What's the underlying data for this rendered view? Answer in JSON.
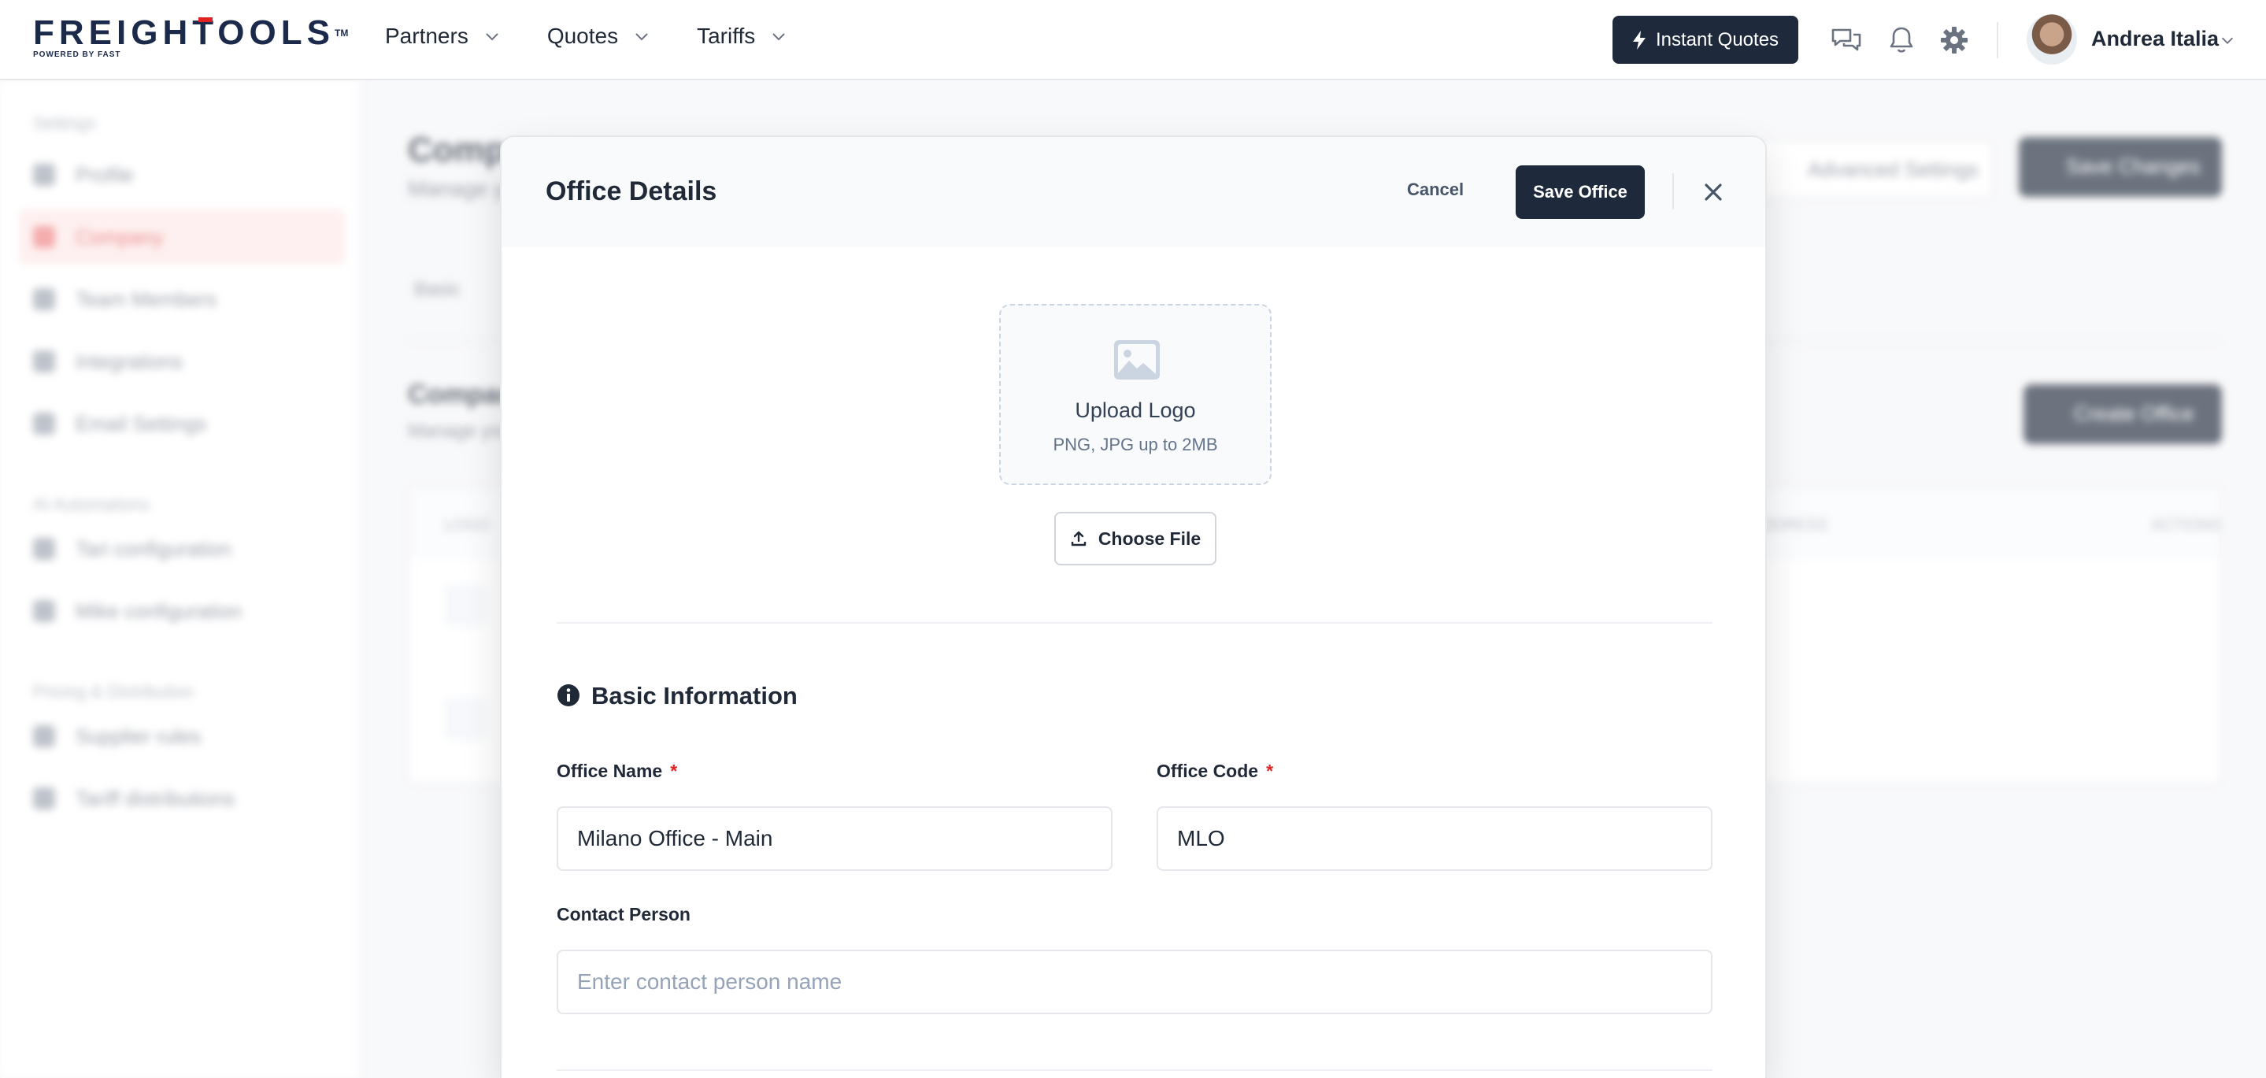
{
  "header": {
    "logo_text": "FREIGHTOOLS",
    "logo_tm": "TM",
    "logo_sub": "POWERED BY FAST",
    "nav": [
      {
        "label": "Partners"
      },
      {
        "label": "Quotes"
      },
      {
        "label": "Tariffs"
      }
    ],
    "instant_quotes_label": "Instant Quotes",
    "user_name": "Andrea Italia"
  },
  "sidebar": {
    "section_settings": "Settings",
    "items_settings": [
      "Profile",
      "Company",
      "Team Members",
      "Integrations",
      "Email Settings"
    ],
    "section_ai": "AI Automations",
    "items_ai": [
      "Tari configuration",
      "Mike configuration"
    ],
    "section_pricing": "Pricing & Distribution",
    "items_pricing": [
      "Supplier rules",
      "Tariff distributions"
    ]
  },
  "background": {
    "page_title": "Company",
    "page_subtitle": "Manage your company",
    "advanced_settings": "Advanced Settings",
    "save_changes": "Save Changes",
    "tab_basic": "Basic",
    "offices_title": "Company",
    "offices_subtitle": "Manage your",
    "create_office": "Create Office",
    "col_logo": "LOGO",
    "col_address": "ADDRESS",
    "col_actions": "ACTIONS"
  },
  "modal": {
    "title": "Office Details",
    "cancel_label": "Cancel",
    "save_label": "Save Office",
    "upload": {
      "title": "Upload Logo",
      "hint": "PNG, JPG up to 2MB",
      "choose_label": "Choose File"
    },
    "basic_info_title": "Basic Information",
    "office_name": {
      "label": "Office Name",
      "required": "*",
      "value": "Milano Office - Main"
    },
    "office_code": {
      "label": "Office Code",
      "required": "*",
      "value": "MLO"
    },
    "contact_person": {
      "label": "Contact Person",
      "placeholder": "Enter contact person name",
      "value": ""
    }
  },
  "colors": {
    "primary_dark": "#1e293b",
    "brand_red": "#e02424",
    "active_sidebar_bg": "#fde8e8"
  },
  "icons": [
    "chevron-down-icon",
    "lightning-icon",
    "chat-icon",
    "bell-icon",
    "gear-icon",
    "close-icon",
    "image-icon",
    "upload-icon",
    "info-icon"
  ]
}
